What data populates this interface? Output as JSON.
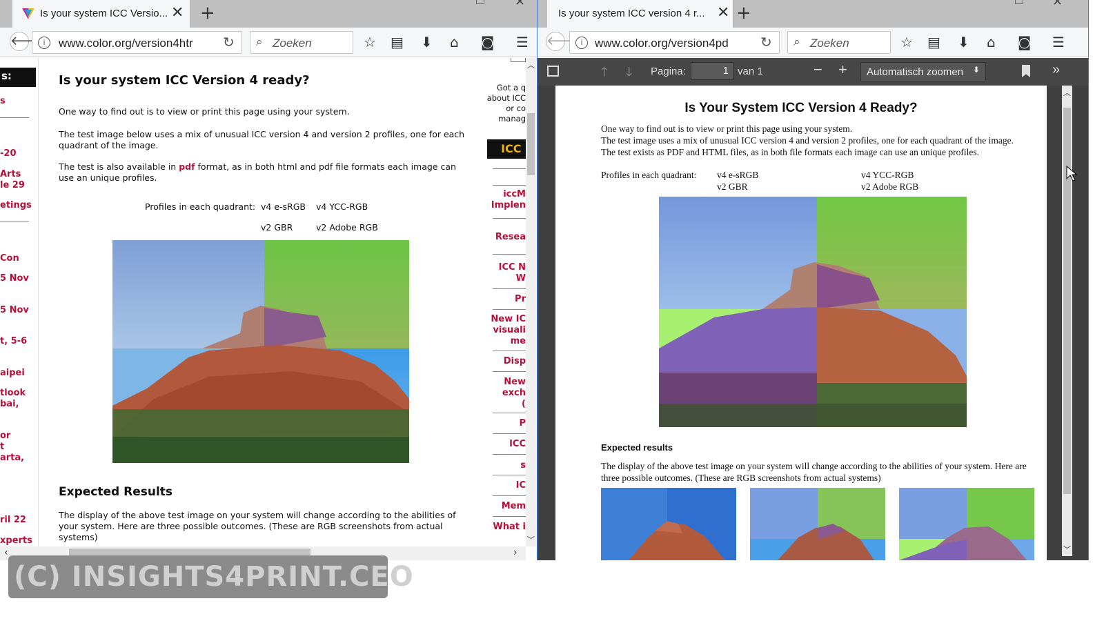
{
  "left_window": {
    "tab_title": "Is your system ICC Versio...",
    "url": "www.color.org/version4htr",
    "search_placeholder": "Zoeken",
    "sidebar_items": [
      "s:",
      "s",
      "-20",
      "Arts\nle 29",
      "etings",
      "Con",
      "5 Nov",
      "5 Nov",
      "t, 5-6",
      "aipei",
      "tlook\nbai,",
      "or\nt\narta,",
      "ril 22",
      "xperts"
    ],
    "page": {
      "title": "Is your system ICC Version 4 ready?",
      "p1": "One way to find out is to view or print this page using your system.",
      "p2": "The test image below uses a mix of unusual ICC version 4 and version 2 profiles, one for each quadrant of the image.",
      "p3_before": "The test is also available in ",
      "p3_link": "pdf",
      "p3_after": " format, as in both html and pdf file formats each image can use an unique profiles.",
      "profiles_label": "Profiles in each quadrant:",
      "q1": "v4 e-sRGB",
      "q2": "v4 YCC-RGB",
      "q3": "v2 GBR",
      "q4": "v2 Adobe RGB",
      "expected_title": "Expected Results",
      "expected_text": "The display of the above test image on your system will change according to the abilities of your system. Here are three possible outcomes. (These are RGB screenshots from actual systems)"
    },
    "right_column": {
      "intro": "Got a q\nabout ICC\nor co\nmanag",
      "logo": "ICC",
      "items": [
        "iccM\nImplen",
        "Resea",
        "ICC N\nW",
        "Pr",
        "New IC\nvisuali\nme",
        "Disp",
        "New\nexch\n(",
        "P",
        "ICC",
        "s",
        "IC",
        "Mem",
        "What i"
      ]
    }
  },
  "right_window": {
    "tab_title": "Is your system ICC version 4 r...",
    "url": "www.color.org/version4pd",
    "search_placeholder": "Zoeken",
    "pdf_toolbar": {
      "page_label": "Pagina:",
      "page_value": "1",
      "page_of": "van 1",
      "zoom": "Automatisch zoomen"
    },
    "pdf": {
      "title": "Is Your System ICC Version 4 Ready?",
      "p1": "One way to find out is to view or print this page using your system.",
      "p2": "The test image uses a mix of unusual ICC version 4 and version 2 profiles, one for each quadrant of the image.",
      "p3": "The test exists as PDF and HTML files, as in both file formats each image can use an unique profiles.",
      "profiles_label": "Profiles in each quadrant:",
      "q1": "v4 e-sRGB",
      "q2": "v4 YCC-RGB",
      "q3": "v2 GBR",
      "q4": "v2 Adobe RGB",
      "expected_title": "Expected results",
      "expected_line1": "The display of the above test image on your system will change according to the abilities of your system. Here are",
      "expected_line2": "three possible outcomes. (These are RGB screenshots from actual systems)"
    }
  },
  "watermark": "(C) INSIGHTS4PRINT.CEO",
  "colors": {
    "link_red": "#b5103a",
    "sky_blue": "#6f9ce0",
    "green_tint": "#73c84a",
    "rock_red": "#b8553a",
    "pdf_toolbar": "#474747"
  }
}
